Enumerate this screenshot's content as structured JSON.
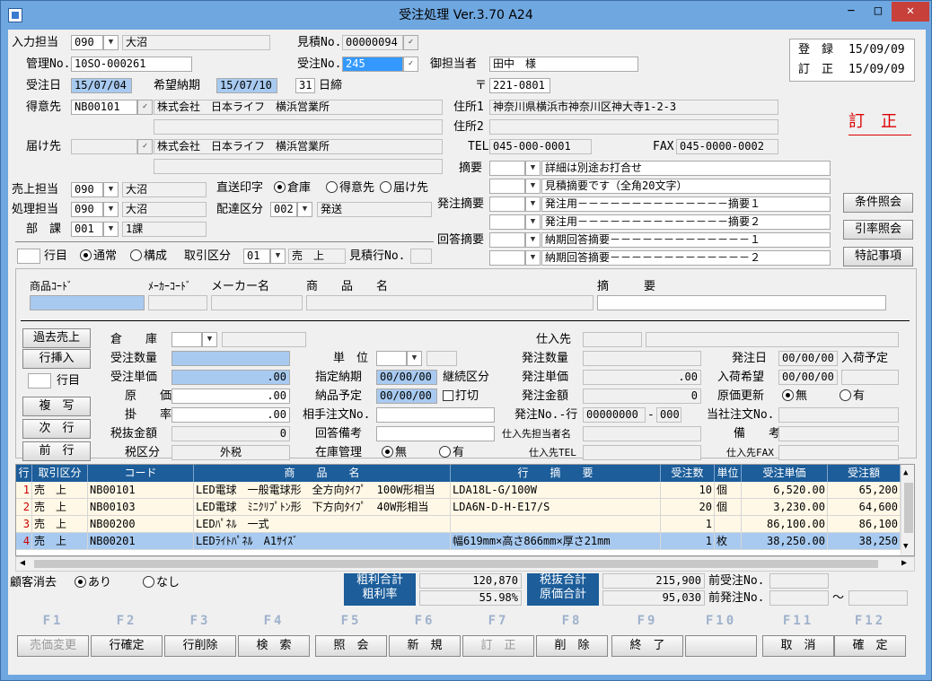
{
  "title": "受注処理 Ver.3.70 A24",
  "window": {
    "min": "−",
    "max": "□",
    "close": "✕"
  },
  "header": {
    "nyuryoku_label": "入力担当",
    "nyuryoku_code": "090",
    "nyuryoku_name": "大沼",
    "mitsumori_label": "見積No.",
    "mitsumori_no": "00000094",
    "kanri_label": "管理No.",
    "kanri_no": "10SO-000261",
    "juchu_label": "受注No.",
    "juchu_no": "245",
    "gotanto_label": "御担当者",
    "gotanto_value": "田中　様",
    "juchubi_label": "受注日",
    "juchubi_value": "15/07/04",
    "kibou_label": "希望納期",
    "kibou_value": "15/07/10",
    "shime_day": "31",
    "shime_label": "日締",
    "zip_label": "〒",
    "zip_value": "221-0801",
    "tokui_label": "得意先",
    "tokui_code": "NB00101",
    "tokui_name": "株式会社　日本ライフ　横浜営業所",
    "addr1_label": "住所1",
    "addr1_value": "神奈川県横浜市神奈川区神大寺1-2-3",
    "addr2_label": "住所2",
    "todoke_label": "届け先",
    "todoke_name": "株式会社　日本ライフ　横浜営業所",
    "tel_label": "TEL",
    "tel_value": "045-000-0001",
    "fax_label": "FAX",
    "fax_value": "045-0000-0002",
    "reg_label": "登　録",
    "reg_date": "15/09/09",
    "mod_label": "訂　正",
    "mod_date": "15/09/09",
    "status_badge": "訂　正"
  },
  "left": {
    "uriage_label": "売上担当",
    "uriage_code": "090",
    "uriage_name": "大沼",
    "shori_label": "処理担当",
    "shori_code": "090",
    "shori_name": "大沼",
    "bu_label": "部　課",
    "bu_code": "001",
    "bu_name": "1課",
    "chokuso_label": "直送印字",
    "chokuso_opts": [
      "倉庫",
      "得意先",
      "届け先"
    ],
    "haitatsu_label": "配達区分",
    "haitatsu_code": "002",
    "haitatsu_name": "発送"
  },
  "tekiyo": {
    "label": "摘要",
    "line1": "詳細は別途お打合せ",
    "line2": "見積摘要です（全角20文字）",
    "hatchu_label": "発注摘要",
    "h1": "発注用－－－－－－－－－－－－－－摘要１",
    "h2": "発注用－－－－－－－－－－－－－－摘要２",
    "kaito_label": "回答摘要",
    "k1": "納期回答摘要－－－－－－－－－－－－－１",
    "k2": "納期回答摘要－－－－－－－－－－－－－２"
  },
  "side_buttons": [
    "条件照会",
    "引率照会",
    "特記事項"
  ],
  "rowline": {
    "gyo_label": "行目",
    "opt1": "通常",
    "opt2": "構成",
    "torihiki_label": "取引区分",
    "torihiki_code": "01",
    "torihiki_name": "売　上",
    "mitsu_gyo_label": "見積行No."
  },
  "product_header": {
    "code": "商品ｺｰﾄﾞ",
    "maker_code": "ﾒｰｶｰｺｰﾄﾞ",
    "maker_name": "メーカー名",
    "name": "商　　品　　名",
    "tekiyo": "摘　　　要"
  },
  "detail_buttons": [
    "過去売上",
    "行挿入",
    "複　写",
    "次　行",
    "前　行"
  ],
  "detail_gyo_label": "行目",
  "detail": {
    "soko": "倉　　庫",
    "juchu_su": "受注数量",
    "juchu_tanka": "受注単価",
    "juchu_tanka_val": ".00",
    "genka": "原　　価",
    "genka_val": ".00",
    "kakeritsu": "掛　　率",
    "kakeritsu_val": ".00",
    "zeinuki": "税抜金額",
    "zeinuki_val": "0",
    "zeikubun": "税区分",
    "zeikubun_val": "外税",
    "tani": "単　位",
    "shitei": "指定納期",
    "shitei_val": "00/00/00",
    "keizoku": "継続区分",
    "nohin": "納品予定",
    "nohin_val": "00/00/00",
    "uchikiri": "打切",
    "aite": "相手注文No.",
    "kaito_biko": "回答備考",
    "zaiko": "在庫管理",
    "zaiko_opts": [
      "無",
      "有"
    ],
    "shiire": "仕入先",
    "hatchu_su": "発注数量",
    "hatchu_tanka": "発注単価",
    "hatchu_tanka_val": ".00",
    "hatchu_kin": "発注金額",
    "hatchu_kin_val": "0",
    "hatchu_no": "発注No.-行",
    "hatchu_no_val": "00000000",
    "hatchu_gyo_val": "000",
    "shiire_tanto": "仕入先担当者名",
    "shiire_tel": "仕入先TEL",
    "hatchubi": "発注日",
    "hatchubi_val": "00/00/00",
    "nyuka_yotei": "入荷予定",
    "nyuka_kibo": "入荷希望",
    "nyuka_kibo_val": "00/00/00",
    "genka_koshin": "原価更新",
    "genka_opts": [
      "無",
      "有"
    ],
    "tosha": "当社注文No.",
    "biko": "備　　考",
    "shiire_fax": "仕入先FAX"
  },
  "grid": {
    "headers": [
      "行",
      "取引区分",
      "コード",
      "商　　品　　名",
      "行　　摘　　要",
      "受注数",
      "単位",
      "受注単価",
      "受注額"
    ],
    "rows": [
      [
        "1",
        "売　上",
        "NB00101",
        "LED電球　一般電球形　全方向ﾀｲﾌﾟ　100W形相当",
        "LDA18L-G/100W",
        "10",
        "個",
        "6,520.00",
        "65,200"
      ],
      [
        "2",
        "売　上",
        "NB00103",
        "LED電球　ﾐﾆｸﾘﾌﾟﾄﾝ形　下方向ﾀｲﾌﾟ　40W形相当",
        "LDA6N-D-H-E17/S",
        "20",
        "個",
        "3,230.00",
        "64,600"
      ],
      [
        "3",
        "売　上",
        "NB00200",
        "LEDﾊﾟﾈﾙ　一式",
        "",
        "1",
        "",
        "86,100.00",
        "86,100"
      ],
      [
        "4",
        "売　上",
        "NB00201",
        "LEDﾗｲﾄﾊﾟﾈﾙ　A1ｻｲｽﾞ",
        "幅619mm×高さ866mm×厚さ21mm",
        "1",
        "枚",
        "38,250.00",
        "38,250"
      ]
    ]
  },
  "footer": {
    "kokyaku_label": "顧客消去",
    "kokyaku_opts": [
      "あり",
      "なし"
    ],
    "arari_gokei": "粗利合計",
    "arari_ritsu": "粗利率",
    "arari_gokei_val": "120,870",
    "arari_ritsu_val": "55.98%",
    "zeinuki_gokei": "税抜合計",
    "genka_gokei": "原価合計",
    "zeinuki_gokei_val": "215,900",
    "genka_gokei_val": "95,030",
    "mae_juchu": "前受注No.",
    "mae_hatchu": "前発注No.",
    "tilde": "～"
  },
  "fkeys": [
    {
      "key": "F1",
      "label": "売価変更"
    },
    {
      "key": "F2",
      "label": "行確定"
    },
    {
      "key": "F3",
      "label": "行削除"
    },
    {
      "key": "F4",
      "label": "検　索"
    },
    {
      "key": "F5",
      "label": "照　会"
    },
    {
      "key": "F6",
      "label": "新　規"
    },
    {
      "key": "F7",
      "label": "訂　正"
    },
    {
      "key": "F8",
      "label": "削　除"
    },
    {
      "key": "F9",
      "label": "終　了"
    },
    {
      "key": "F10",
      "label": ""
    },
    {
      "key": "F11",
      "label": "取　消"
    },
    {
      "key": "F12",
      "label": "確　定"
    }
  ]
}
